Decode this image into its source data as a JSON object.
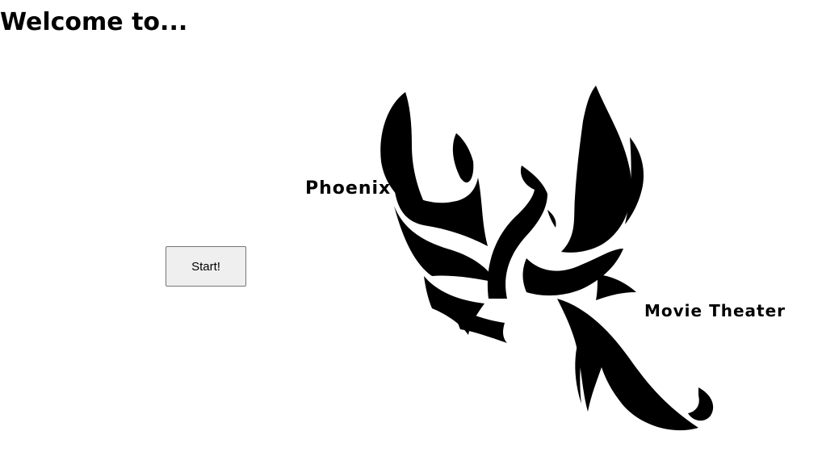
{
  "header": {
    "title": "Welcome to..."
  },
  "actions": {
    "start_label": "Start!"
  },
  "logo": {
    "icon": "phoenix-icon",
    "word_top": "Phoenix",
    "word_bottom": "Movie Theater",
    "color": "#000000"
  }
}
